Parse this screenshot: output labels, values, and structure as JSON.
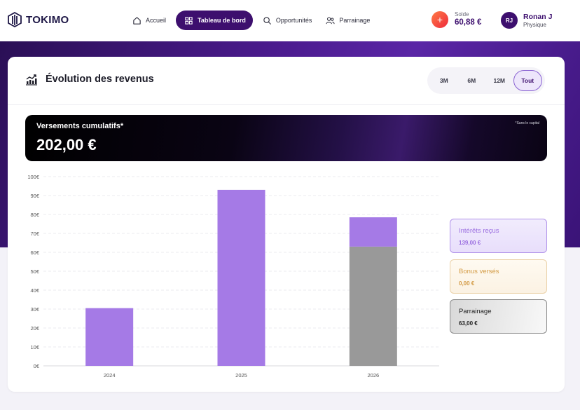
{
  "brand": {
    "name": "TOKIMO"
  },
  "nav": {
    "items": [
      {
        "label": "Accueil",
        "icon": "home-icon"
      },
      {
        "label": "Tableau de bord",
        "icon": "dashboard-icon",
        "active": true
      },
      {
        "label": "Opportunités",
        "icon": "search-icon"
      },
      {
        "label": "Parrainage",
        "icon": "users-icon"
      }
    ]
  },
  "balance": {
    "label": "Solde",
    "value": "60,88 €",
    "action": "+"
  },
  "user": {
    "initials": "RJ",
    "name": "Ronan J",
    "type": "Physique"
  },
  "card": {
    "title": "Évolution des revenus",
    "ranges": [
      {
        "label": "3M"
      },
      {
        "label": "6M"
      },
      {
        "label": "12M"
      },
      {
        "label": "Tout",
        "active": true
      }
    ],
    "total": {
      "label": "Versements cumulatifs*",
      "value": "202,00 €",
      "note": "*Sans le capital"
    }
  },
  "legend": {
    "interets": {
      "label": "Intérêts reçus",
      "value": "139,00 €"
    },
    "bonus": {
      "label": "Bonus versés",
      "value": "0,00 €"
    },
    "parrainage": {
      "label": "Parrainage",
      "value": "63,00 €"
    }
  },
  "colors": {
    "brand": "#3d0f6e",
    "interets": "#a57ae6",
    "bonus": "#e8b66a",
    "parrainage": "#999999"
  },
  "chart_data": {
    "type": "bar",
    "stacked": true,
    "categories": [
      "2024",
      "2025",
      "2026"
    ],
    "series": [
      {
        "name": "Parrainage",
        "values": [
          0,
          0,
          63
        ]
      },
      {
        "name": "Intérêts reçus",
        "values": [
          30.5,
          93,
          15.5
        ]
      }
    ],
    "ylim": [
      0,
      100
    ],
    "yticks": [
      "0€",
      "10€",
      "20€",
      "30€",
      "40€",
      "50€",
      "60€",
      "70€",
      "80€",
      "90€",
      "100€"
    ],
    "grid": true
  }
}
